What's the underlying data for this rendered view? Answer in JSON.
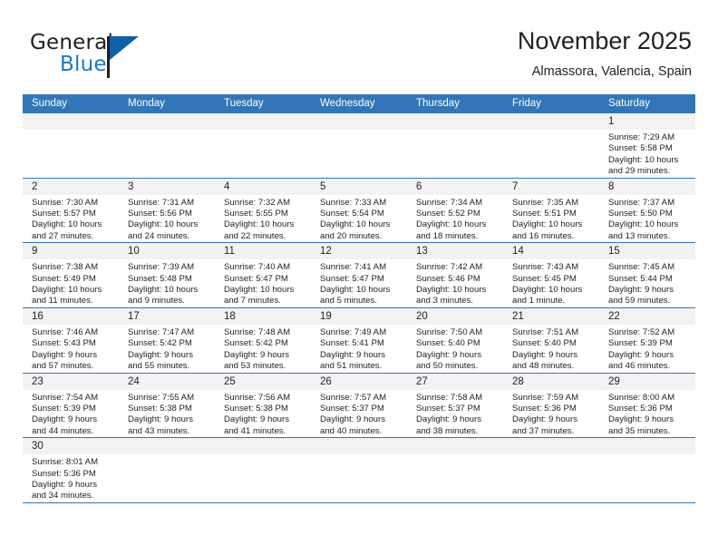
{
  "brand": {
    "name_top": "General",
    "name_bottom": "Blue",
    "triangle_icon": "blue-triangle-logo",
    "color_dark": "#231f20",
    "color_blue": "#1b79c4"
  },
  "header": {
    "title": "November 2025",
    "subtitle": "Almassora, Valencia, Spain"
  },
  "theme": {
    "header_blue": "#3276b8",
    "daynum_gray": "#f2f2f2",
    "text": "#231f20"
  },
  "weekday_headers": [
    "Sunday",
    "Monday",
    "Tuesday",
    "Wednesday",
    "Thursday",
    "Friday",
    "Saturday"
  ],
  "weeks": [
    [
      {
        "day": "",
        "lines": []
      },
      {
        "day": "",
        "lines": []
      },
      {
        "day": "",
        "lines": []
      },
      {
        "day": "",
        "lines": []
      },
      {
        "day": "",
        "lines": []
      },
      {
        "day": "",
        "lines": []
      },
      {
        "day": "1",
        "lines": [
          "Sunrise: 7:29 AM",
          "Sunset: 5:58 PM",
          "Daylight: 10 hours",
          "and 29 minutes."
        ]
      }
    ],
    [
      {
        "day": "2",
        "lines": [
          "Sunrise: 7:30 AM",
          "Sunset: 5:57 PM",
          "Daylight: 10 hours",
          "and 27 minutes."
        ]
      },
      {
        "day": "3",
        "lines": [
          "Sunrise: 7:31 AM",
          "Sunset: 5:56 PM",
          "Daylight: 10 hours",
          "and 24 minutes."
        ]
      },
      {
        "day": "4",
        "lines": [
          "Sunrise: 7:32 AM",
          "Sunset: 5:55 PM",
          "Daylight: 10 hours",
          "and 22 minutes."
        ]
      },
      {
        "day": "5",
        "lines": [
          "Sunrise: 7:33 AM",
          "Sunset: 5:54 PM",
          "Daylight: 10 hours",
          "and 20 minutes."
        ]
      },
      {
        "day": "6",
        "lines": [
          "Sunrise: 7:34 AM",
          "Sunset: 5:52 PM",
          "Daylight: 10 hours",
          "and 18 minutes."
        ]
      },
      {
        "day": "7",
        "lines": [
          "Sunrise: 7:35 AM",
          "Sunset: 5:51 PM",
          "Daylight: 10 hours",
          "and 16 minutes."
        ]
      },
      {
        "day": "8",
        "lines": [
          "Sunrise: 7:37 AM",
          "Sunset: 5:50 PM",
          "Daylight: 10 hours",
          "and 13 minutes."
        ]
      }
    ],
    [
      {
        "day": "9",
        "lines": [
          "Sunrise: 7:38 AM",
          "Sunset: 5:49 PM",
          "Daylight: 10 hours",
          "and 11 minutes."
        ]
      },
      {
        "day": "10",
        "lines": [
          "Sunrise: 7:39 AM",
          "Sunset: 5:48 PM",
          "Daylight: 10 hours",
          "and 9 minutes."
        ]
      },
      {
        "day": "11",
        "lines": [
          "Sunrise: 7:40 AM",
          "Sunset: 5:47 PM",
          "Daylight: 10 hours",
          "and 7 minutes."
        ]
      },
      {
        "day": "12",
        "lines": [
          "Sunrise: 7:41 AM",
          "Sunset: 5:47 PM",
          "Daylight: 10 hours",
          "and 5 minutes."
        ]
      },
      {
        "day": "13",
        "lines": [
          "Sunrise: 7:42 AM",
          "Sunset: 5:46 PM",
          "Daylight: 10 hours",
          "and 3 minutes."
        ]
      },
      {
        "day": "14",
        "lines": [
          "Sunrise: 7:43 AM",
          "Sunset: 5:45 PM",
          "Daylight: 10 hours",
          "and 1 minute."
        ]
      },
      {
        "day": "15",
        "lines": [
          "Sunrise: 7:45 AM",
          "Sunset: 5:44 PM",
          "Daylight: 9 hours",
          "and 59 minutes."
        ]
      }
    ],
    [
      {
        "day": "16",
        "lines": [
          "Sunrise: 7:46 AM",
          "Sunset: 5:43 PM",
          "Daylight: 9 hours",
          "and 57 minutes."
        ]
      },
      {
        "day": "17",
        "lines": [
          "Sunrise: 7:47 AM",
          "Sunset: 5:42 PM",
          "Daylight: 9 hours",
          "and 55 minutes."
        ]
      },
      {
        "day": "18",
        "lines": [
          "Sunrise: 7:48 AM",
          "Sunset: 5:42 PM",
          "Daylight: 9 hours",
          "and 53 minutes."
        ]
      },
      {
        "day": "19",
        "lines": [
          "Sunrise: 7:49 AM",
          "Sunset: 5:41 PM",
          "Daylight: 9 hours",
          "and 51 minutes."
        ]
      },
      {
        "day": "20",
        "lines": [
          "Sunrise: 7:50 AM",
          "Sunset: 5:40 PM",
          "Daylight: 9 hours",
          "and 50 minutes."
        ]
      },
      {
        "day": "21",
        "lines": [
          "Sunrise: 7:51 AM",
          "Sunset: 5:40 PM",
          "Daylight: 9 hours",
          "and 48 minutes."
        ]
      },
      {
        "day": "22",
        "lines": [
          "Sunrise: 7:52 AM",
          "Sunset: 5:39 PM",
          "Daylight: 9 hours",
          "and 46 minutes."
        ]
      }
    ],
    [
      {
        "day": "23",
        "lines": [
          "Sunrise: 7:54 AM",
          "Sunset: 5:39 PM",
          "Daylight: 9 hours",
          "and 44 minutes."
        ]
      },
      {
        "day": "24",
        "lines": [
          "Sunrise: 7:55 AM",
          "Sunset: 5:38 PM",
          "Daylight: 9 hours",
          "and 43 minutes."
        ]
      },
      {
        "day": "25",
        "lines": [
          "Sunrise: 7:56 AM",
          "Sunset: 5:38 PM",
          "Daylight: 9 hours",
          "and 41 minutes."
        ]
      },
      {
        "day": "26",
        "lines": [
          "Sunrise: 7:57 AM",
          "Sunset: 5:37 PM",
          "Daylight: 9 hours",
          "and 40 minutes."
        ]
      },
      {
        "day": "27",
        "lines": [
          "Sunrise: 7:58 AM",
          "Sunset: 5:37 PM",
          "Daylight: 9 hours",
          "and 38 minutes."
        ]
      },
      {
        "day": "28",
        "lines": [
          "Sunrise: 7:59 AM",
          "Sunset: 5:36 PM",
          "Daylight: 9 hours",
          "and 37 minutes."
        ]
      },
      {
        "day": "29",
        "lines": [
          "Sunrise: 8:00 AM",
          "Sunset: 5:36 PM",
          "Daylight: 9 hours",
          "and 35 minutes."
        ]
      }
    ],
    [
      {
        "day": "30",
        "lines": [
          "Sunrise: 8:01 AM",
          "Sunset: 5:36 PM",
          "Daylight: 9 hours",
          "and 34 minutes."
        ]
      },
      {
        "day": "",
        "lines": []
      },
      {
        "day": "",
        "lines": []
      },
      {
        "day": "",
        "lines": []
      },
      {
        "day": "",
        "lines": []
      },
      {
        "day": "",
        "lines": []
      },
      {
        "day": "",
        "lines": []
      }
    ]
  ]
}
